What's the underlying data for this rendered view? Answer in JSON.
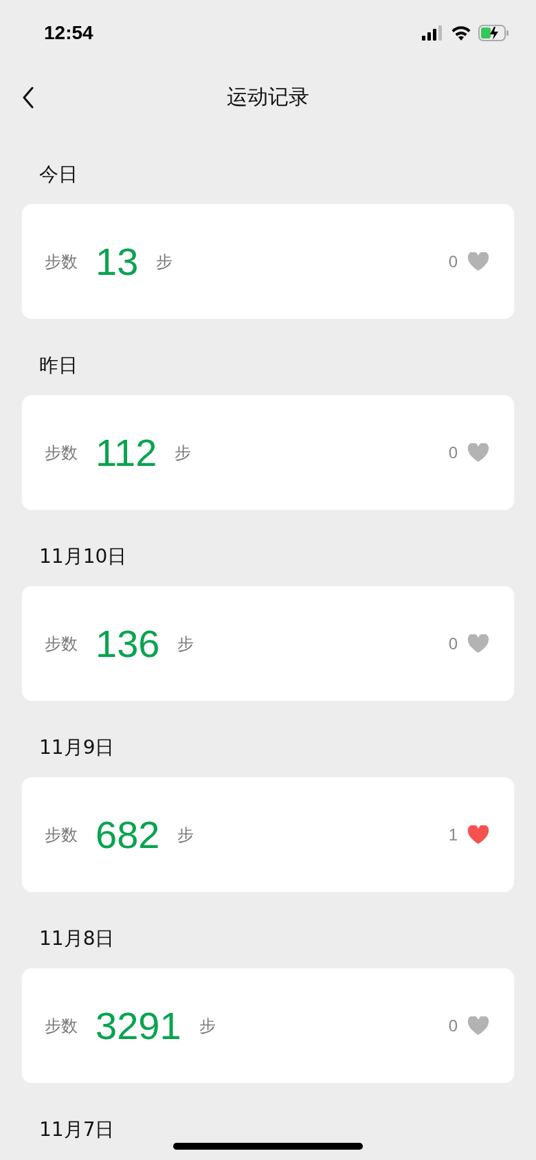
{
  "status_bar": {
    "time": "12:54"
  },
  "nav": {
    "title": "运动记录"
  },
  "records": [
    {
      "date": "今日",
      "label": "步数",
      "steps": "13",
      "unit": "步",
      "likes": "0",
      "liked": false
    },
    {
      "date": "昨日",
      "label": "步数",
      "steps": "112",
      "unit": "步",
      "likes": "0",
      "liked": false
    },
    {
      "date": "11月10日",
      "label": "步数",
      "steps": "136",
      "unit": "步",
      "likes": "0",
      "liked": false
    },
    {
      "date": "11月9日",
      "label": "步数",
      "steps": "682",
      "unit": "步",
      "likes": "1",
      "liked": true
    },
    {
      "date": "11月8日",
      "label": "步数",
      "steps": "3291",
      "unit": "步",
      "likes": "0",
      "liked": false
    }
  ],
  "partial_section": {
    "date": "11月7日"
  }
}
